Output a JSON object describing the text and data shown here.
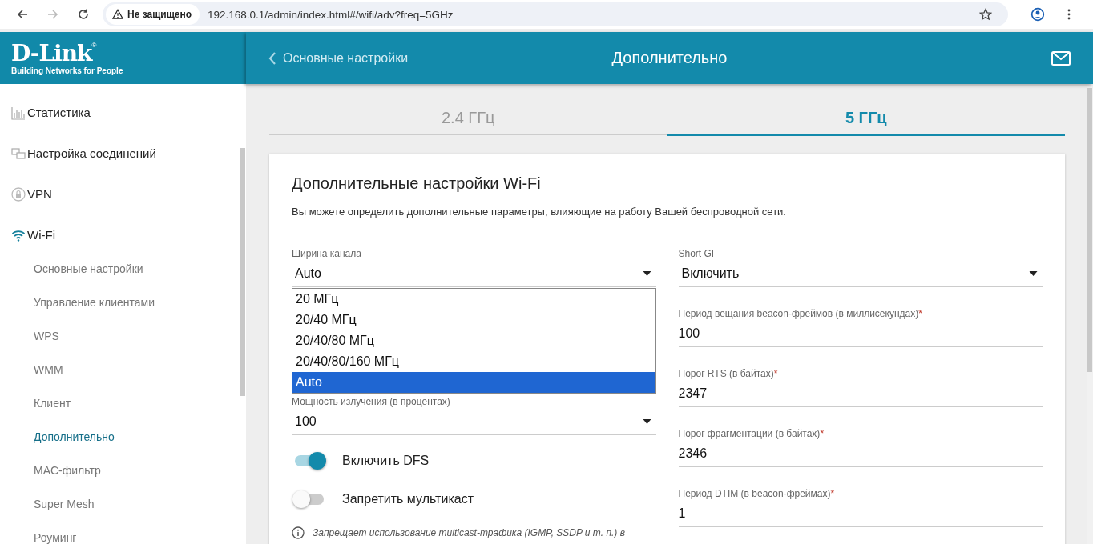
{
  "browser": {
    "security_label": "Не защищено",
    "url": "192.168.0.1/admin/index.html#/wifi/adv?freq=5GHz"
  },
  "header": {
    "logo": "D-Link",
    "logo_mark": "®",
    "tagline": "Building Networks for People",
    "back_label": "Основные настройки",
    "title": "Дополнительно"
  },
  "sidebar": {
    "items": [
      {
        "label": "Статистика"
      },
      {
        "label": "Настройка соединений"
      },
      {
        "label": "VPN"
      },
      {
        "label": "Wi-Fi",
        "children": [
          {
            "label": "Основные настройки",
            "selected": false
          },
          {
            "label": "Управление клиентами",
            "selected": false
          },
          {
            "label": "WPS",
            "selected": false
          },
          {
            "label": "WMM",
            "selected": false
          },
          {
            "label": "Клиент",
            "selected": false
          },
          {
            "label": "Дополнительно",
            "selected": true
          },
          {
            "label": "MAC-фильтр",
            "selected": false
          },
          {
            "label": "Super Mesh",
            "selected": false
          },
          {
            "label": "Роуминг",
            "selected": false
          }
        ]
      }
    ]
  },
  "tabs": [
    {
      "label": "2.4 ГГц",
      "selected": false
    },
    {
      "label": "5 ГГц",
      "selected": true
    }
  ],
  "card": {
    "title": "Дополнительные настройки Wi-Fi",
    "description": "Вы можете определить дополнительные параметры, влияющие на работу Вашей беспроводной сети.",
    "left_fields": [
      {
        "kind": "select",
        "label": "Ширина канала",
        "value": "Auto",
        "options": [
          {
            "label": "20 МГц",
            "selected": false
          },
          {
            "label": "20/40 МГц",
            "selected": false
          },
          {
            "label": "20/40/80 МГц",
            "selected": false
          },
          {
            "label": "20/40/80/160 МГц",
            "selected": false
          },
          {
            "label": "Auto",
            "selected": true
          }
        ]
      },
      {
        "kind": "select",
        "label": "Мощность излучения (в процентах)",
        "value": "100"
      }
    ],
    "toggles": [
      {
        "label": "Включить DFS",
        "on": true
      },
      {
        "label": "Запретить мультикаст",
        "on": false
      }
    ],
    "note": "Запрещает использование multicast-трафика (IGMP, SSDP и т. п.) в",
    "right_fields": [
      {
        "kind": "select",
        "label": "Short GI",
        "value": "Включить"
      },
      {
        "kind": "input",
        "label": "Период вещания beacon-фреймов (в миллисекундах)",
        "required_mark": "*",
        "value": "100"
      },
      {
        "kind": "input",
        "label": "Порог RTS (в байтах)",
        "required_mark": "*",
        "value": "2347"
      },
      {
        "kind": "input",
        "label": "Порог фрагментации (в байтах)",
        "required_mark": "*",
        "value": "2346"
      },
      {
        "kind": "input",
        "label": "Период DTIM (в beacon-фреймах)",
        "required_mark": "*",
        "value": "1"
      }
    ]
  }
}
